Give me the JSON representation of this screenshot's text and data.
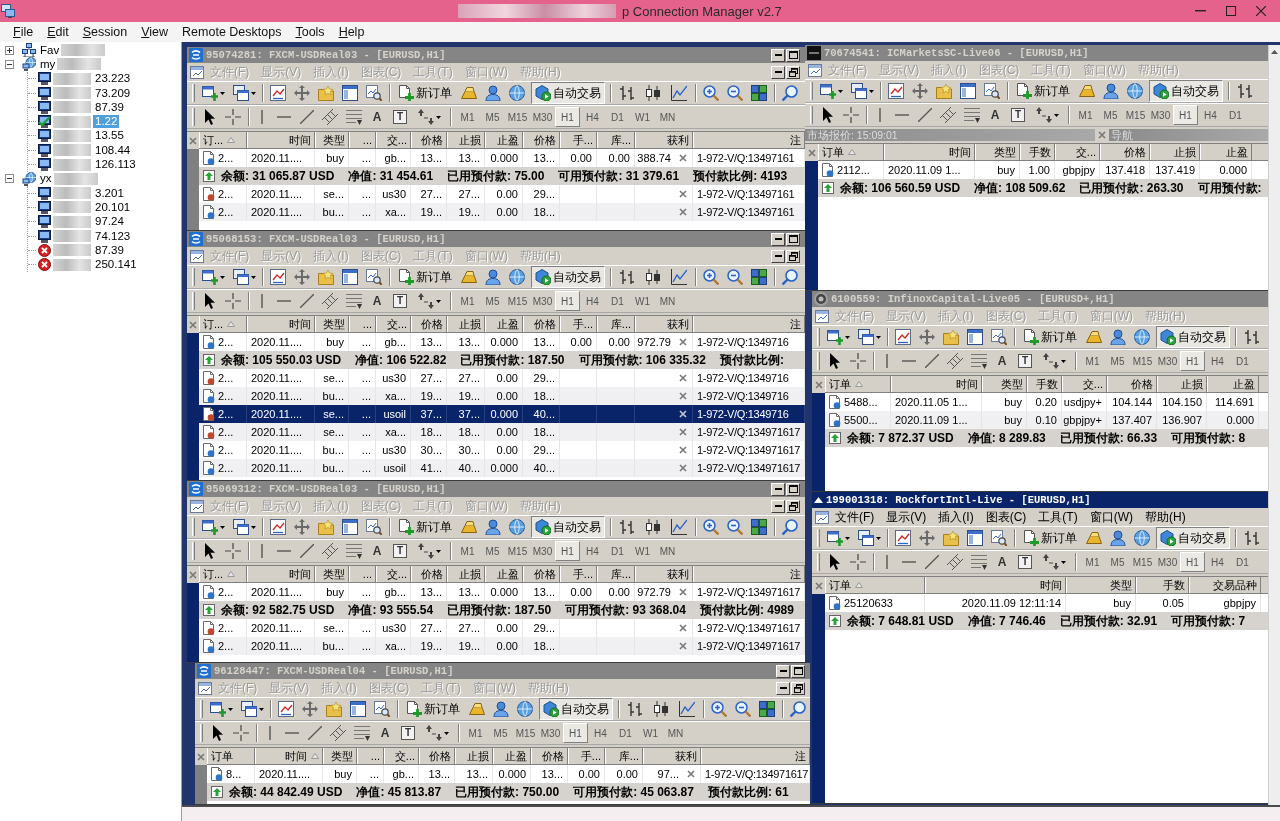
{
  "title_bar": {
    "title": "p Connection Manager v2.7"
  },
  "menu_bar": [
    {
      "label": "File",
      "underlined": true
    },
    {
      "label": "Edit",
      "underlined": true
    },
    {
      "label": "Session",
      "underlined": true
    },
    {
      "label": "View",
      "underlined": true
    },
    {
      "label": "Remote Desktops",
      "underlined": false
    },
    {
      "label": "Tools",
      "underlined": true
    },
    {
      "label": "Help",
      "underlined": true
    }
  ],
  "tree": [
    {
      "label": "Fav",
      "kind": "favorites",
      "expanded": false
    },
    {
      "label": "my",
      "kind": "group",
      "expanded": true,
      "children": [
        {
          "label": "23.223",
          "kind": "idle",
          "selected": false
        },
        {
          "label": "73.209",
          "kind": "idle",
          "selected": false
        },
        {
          "label": "87.39",
          "kind": "idle",
          "selected": false
        },
        {
          "label": "1.22",
          "kind": "connected",
          "selected": true
        },
        {
          "label": "13.55",
          "kind": "idle",
          "selected": false
        },
        {
          "label": "108.44",
          "kind": "idle",
          "selected": false
        },
        {
          "label": "126.113",
          "kind": "idle",
          "selected": false
        }
      ]
    },
    {
      "label": "yx",
      "kind": "group",
      "expanded": true,
      "children": [
        {
          "label": "3.201",
          "kind": "idle",
          "selected": false
        },
        {
          "label": "20.101",
          "kind": "idle",
          "selected": false
        },
        {
          "label": "97.24",
          "kind": "idle",
          "selected": false
        },
        {
          "label": "74.123",
          "kind": "idle",
          "selected": false
        },
        {
          "label": "87.39",
          "kind": "failed",
          "selected": false
        },
        {
          "label": "250.141",
          "kind": "failed",
          "selected": false
        }
      ]
    }
  ],
  "left_column": [
    {
      "kind": "swoosh",
      "title": "95074281: FXCM-USDReal03 - [EURUSD,H1]",
      "focused": false,
      "menu": [
        "文件(F)",
        "显示(V)",
        "插入(I)",
        "图表(C)",
        "工具(T)",
        "窗口(W)",
        "帮助(H)"
      ],
      "new_order": "新订单",
      "auto_trading": {
        "label": "自动交易",
        "on": true
      },
      "text_tool": "A",
      "label_tool": "T",
      "timeframes": [
        {
          "label": "M1",
          "selected": false
        },
        {
          "label": "M5",
          "selected": false
        },
        {
          "label": "M15",
          "selected": false
        },
        {
          "label": "M30",
          "selected": false
        },
        {
          "label": "H1",
          "selected": true
        },
        {
          "label": "H4",
          "selected": false
        },
        {
          "label": "D1",
          "selected": false
        },
        {
          "label": "W1",
          "selected": false
        },
        {
          "label": "MN",
          "selected": false
        }
      ],
      "terminal_focused": false,
      "columns": [
        {
          "label": "订...",
          "sorted": true
        },
        {
          "label": "时间",
          "sorted": false
        },
        {
          "label": "类型",
          "sorted": false
        },
        {
          "label": "...",
          "sorted": false
        },
        {
          "label": "交...",
          "sorted": false
        },
        {
          "label": "价格",
          "sorted": false
        },
        {
          "label": "止损",
          "sorted": false
        },
        {
          "label": "止盈",
          "sorted": false
        },
        {
          "label": "价格",
          "sorted": false
        },
        {
          "label": "手...",
          "sorted": false
        },
        {
          "label": "库...",
          "sorted": false
        },
        {
          "label": "获利",
          "sorted": false
        },
        {
          "label": "注",
          "sorted": false
        }
      ],
      "rows": [
        {
          "kind": "order",
          "selected": false,
          "color": "#2d74c6",
          "cells": [
            "2...",
            "2020.11....",
            "buy",
            "...",
            "gb...",
            "13...",
            "13...",
            "0.000",
            "13...",
            "0.00",
            "0.00",
            "388.74",
            "1-972-V/Q:13497161"
          ]
        },
        {
          "kind": "summary",
          "items": [
            "余额: 31 065.87 USD",
            "净值: 31 454.61",
            "已用预付款: 75.00",
            "可用预付款: 31 379.61",
            "预付款比例: 4193"
          ]
        },
        {
          "kind": "order",
          "selected": false,
          "color": "#c0462e",
          "cells": [
            "2...",
            "2020.11....",
            "se...",
            "...",
            "us30",
            "27...",
            "27...",
            "0.00",
            "29...",
            null,
            null,
            null,
            "1-972-V/Q:13497161"
          ]
        },
        {
          "kind": "order",
          "selected": false,
          "color": "#2d74c6",
          "cells": [
            "2...",
            "2020.11....",
            "bu...",
            "...",
            "xa...",
            "19...",
            "19...",
            "0.00",
            "18...",
            null,
            null,
            null,
            "1-972-V/Q:13497161"
          ]
        }
      ]
    },
    {
      "kind": "swoosh",
      "title": "95068153: FXCM-USDReal03 - [EURUSD,H1]",
      "focused": false,
      "menu": [
        "文件(F)",
        "显示(V)",
        "插入(I)",
        "图表(C)",
        "工具(T)",
        "窗口(W)",
        "帮助(H)"
      ],
      "new_order": "新订单",
      "auto_trading": {
        "label": "自动交易",
        "on": true
      },
      "text_tool": "A",
      "label_tool": "T",
      "timeframes": [
        {
          "label": "M1",
          "selected": false
        },
        {
          "label": "M5",
          "selected": false
        },
        {
          "label": "M15",
          "selected": false
        },
        {
          "label": "M30",
          "selected": false
        },
        {
          "label": "H1",
          "selected": true
        },
        {
          "label": "H4",
          "selected": false
        },
        {
          "label": "D1",
          "selected": false
        },
        {
          "label": "W1",
          "selected": false
        },
        {
          "label": "MN",
          "selected": false
        }
      ],
      "terminal_focused": true,
      "columns": [
        {
          "label": "订...",
          "sorted": true
        },
        {
          "label": "时间",
          "sorted": false
        },
        {
          "label": "类型",
          "sorted": false
        },
        {
          "label": "...",
          "sorted": false
        },
        {
          "label": "交...",
          "sorted": false
        },
        {
          "label": "价格",
          "sorted": false
        },
        {
          "label": "止损",
          "sorted": false
        },
        {
          "label": "止盈",
          "sorted": false
        },
        {
          "label": "价格",
          "sorted": false
        },
        {
          "label": "手...",
          "sorted": false
        },
        {
          "label": "库...",
          "sorted": false
        },
        {
          "label": "获利",
          "sorted": false
        },
        {
          "label": "注",
          "sorted": false
        }
      ],
      "rows": [
        {
          "kind": "order",
          "selected": false,
          "color": "#2d74c6",
          "cells": [
            "2...",
            "2020.11....",
            "buy",
            "...",
            "gb...",
            "13...",
            "13...",
            "0.000",
            "13...",
            "0.00",
            "0.00",
            "972.79",
            "1-972-V/Q:1349716"
          ]
        },
        {
          "kind": "summary",
          "items": [
            "余额: 105 550.03 USD",
            "净值: 106 522.82",
            "已用预付款: 187.50",
            "可用预付款: 106 335.32",
            "预付款比例:"
          ]
        },
        {
          "kind": "order",
          "selected": false,
          "color": "#c0462e",
          "cells": [
            "2...",
            "2020.11....",
            "se...",
            "...",
            "us30",
            "27...",
            "27...",
            "0.00",
            "29...",
            null,
            null,
            null,
            "1-972-V/Q:1349716"
          ]
        },
        {
          "kind": "order",
          "selected": false,
          "color": "#2d74c6",
          "cells": [
            "2...",
            "2020.11....",
            "bu...",
            "...",
            "xa...",
            "19...",
            "19...",
            "0.00",
            "18...",
            null,
            null,
            null,
            "1-972-V/Q:1349716"
          ]
        },
        {
          "kind": "order",
          "selected": true,
          "color": "#c0462e",
          "cells": [
            "2...",
            "2020.11....",
            "se...",
            "...",
            "usoil",
            "37...",
            "37...",
            "0.000",
            "40...",
            null,
            null,
            null,
            "1-972-V/Q:1349716"
          ]
        },
        {
          "kind": "order",
          "selected": false,
          "color": "#c0462e",
          "cells": [
            "2...",
            "2020.11....",
            "se...",
            "...",
            "xa...",
            "18...",
            "18...",
            "0.00",
            "18...",
            null,
            null,
            null,
            "1-972-V/Q:134971617"
          ]
        },
        {
          "kind": "order",
          "selected": false,
          "color": "#2d74c6",
          "cells": [
            "2...",
            "2020.11....",
            "bu...",
            "...",
            "us30",
            "30...",
            "30...",
            "0.00",
            "29...",
            null,
            null,
            null,
            "1-972-V/Q:134971617"
          ]
        },
        {
          "kind": "order",
          "selected": false,
          "color": "#2d74c6",
          "cells": [
            "2...",
            "2020.11....",
            "bu...",
            "...",
            "usoil",
            "41...",
            "40...",
            "0.000",
            "40...",
            null,
            null,
            null,
            "1-972-V/Q:134971617"
          ]
        }
      ]
    },
    {
      "kind": "swoosh",
      "title": "95069312: FXCM-USDReal03 - [EURUSD,H1]",
      "focused": false,
      "menu": [
        "文件(F)",
        "显示(V)",
        "插入(I)",
        "图表(C)",
        "工具(T)",
        "窗口(W)",
        "帮助(H)"
      ],
      "new_order": "新订单",
      "auto_trading": {
        "label": "自动交易",
        "on": true
      },
      "text_tool": "A",
      "label_tool": "T",
      "timeframes": [
        {
          "label": "M1",
          "selected": false
        },
        {
          "label": "M5",
          "selected": false
        },
        {
          "label": "M15",
          "selected": false
        },
        {
          "label": "M30",
          "selected": false
        },
        {
          "label": "H1",
          "selected": true
        },
        {
          "label": "H4",
          "selected": false
        },
        {
          "label": "D1",
          "selected": false
        },
        {
          "label": "W1",
          "selected": false
        },
        {
          "label": "MN",
          "selected": false
        }
      ],
      "terminal_focused": true,
      "columns": [
        {
          "label": "订...",
          "sorted": true
        },
        {
          "label": "时间",
          "sorted": false
        },
        {
          "label": "类型",
          "sorted": false
        },
        {
          "label": "...",
          "sorted": false
        },
        {
          "label": "交...",
          "sorted": false
        },
        {
          "label": "价格",
          "sorted": false
        },
        {
          "label": "止损",
          "sorted": false
        },
        {
          "label": "止盈",
          "sorted": false
        },
        {
          "label": "价格",
          "sorted": false
        },
        {
          "label": "手...",
          "sorted": false
        },
        {
          "label": "库...",
          "sorted": false
        },
        {
          "label": "获利",
          "sorted": false
        },
        {
          "label": "注",
          "sorted": false
        }
      ],
      "rows": [
        {
          "kind": "order",
          "selected": false,
          "color": "#2d74c6",
          "cells": [
            "2...",
            "2020.11....",
            "buy",
            "...",
            "gb...",
            "13...",
            "13...",
            "0.000",
            "13...",
            "0.00",
            "0.00",
            "972.79",
            "1-972-V/Q:134971617"
          ]
        },
        {
          "kind": "summary",
          "items": [
            "余额: 92 582.75 USD",
            "净值: 93 555.54",
            "已用预付款: 187.50",
            "可用预付款: 93 368.04",
            "预付款比例: 4989"
          ]
        },
        {
          "kind": "order",
          "selected": false,
          "color": "#c0462e",
          "cells": [
            "2...",
            "2020.11....",
            "se...",
            "...",
            "us30",
            "27...",
            "27...",
            "0.00",
            "29...",
            null,
            null,
            null,
            "1-972-V/Q:134971617"
          ]
        },
        {
          "kind": "order",
          "selected": false,
          "color": "#2d74c6",
          "cells": [
            "2...",
            "2020.11....",
            "bu...",
            "...",
            "xa...",
            "19...",
            "19...",
            "0.00",
            "18...",
            null,
            null,
            null,
            "1-972-V/Q:134971617"
          ]
        }
      ]
    },
    {
      "kind": "swoosh",
      "title": "96128447: FXCM-USDReal04 - [EURUSD,H1]",
      "focused": false,
      "menu": [
        "文件(F)",
        "显示(V)",
        "插入(I)",
        "图表(C)",
        "工具(T)",
        "窗口(W)",
        "帮助(H)"
      ],
      "new_order": "新订单",
      "auto_trading": {
        "label": "自动交易",
        "on": true
      },
      "text_tool": "A",
      "label_tool": "T",
      "timeframes": [
        {
          "label": "M1",
          "selected": false
        },
        {
          "label": "M5",
          "selected": false
        },
        {
          "label": "M15",
          "selected": false
        },
        {
          "label": "M30",
          "selected": false
        },
        {
          "label": "H1",
          "selected": true
        },
        {
          "label": "H4",
          "selected": false
        },
        {
          "label": "D1",
          "selected": false
        },
        {
          "label": "W1",
          "selected": false
        },
        {
          "label": "MN",
          "selected": false
        }
      ],
      "terminal_focused": false,
      "columns": [
        {
          "label": "订单",
          "sorted": false
        },
        {
          "label": "时间",
          "sorted": true
        },
        {
          "label": "类型",
          "sorted": false
        },
        {
          "label": "...",
          "sorted": false
        },
        {
          "label": "交...",
          "sorted": false
        },
        {
          "label": "价格",
          "sorted": false
        },
        {
          "label": "止损",
          "sorted": false
        },
        {
          "label": "止盈",
          "sorted": false
        },
        {
          "label": "价格",
          "sorted": false
        },
        {
          "label": "手...",
          "sorted": false
        },
        {
          "label": "库...",
          "sorted": false
        },
        {
          "label": "获利",
          "sorted": false
        },
        {
          "label": "注",
          "sorted": false
        }
      ],
      "rows": [
        {
          "kind": "order",
          "selected": false,
          "color": "#2d74c6",
          "cells": [
            "8...",
            "2020.11....",
            "buy",
            "...",
            "gb...",
            "13...",
            "13...",
            "0.000",
            "13...",
            "0.00",
            "0.00",
            "97...",
            "1-972-V/Q:134971617"
          ]
        },
        {
          "kind": "summary",
          "items": [
            "余额: 44 842.49 USD",
            "净值: 45 813.87",
            "已用预付款: 750.00",
            "可用预付款: 45 063.87",
            "预付款比例: 61"
          ]
        }
      ]
    }
  ],
  "right_column": [
    {
      "kind": "dash",
      "title": "70674541: ICMarketsSC-Live06 - [EURUSD,H1]",
      "focused": false,
      "menu": [
        "文件(F)",
        "显示(V)",
        "插入(I)",
        "图表(C)",
        "工具(T)",
        "窗口(W)",
        "帮助(H)"
      ],
      "new_order": "新订单",
      "auto_trading": {
        "label": "自动交易",
        "on": true
      },
      "text_tool": "A",
      "label_tool": "T",
      "timeframes": [
        {
          "label": "M1",
          "selected": false
        },
        {
          "label": "M5",
          "selected": false
        },
        {
          "label": "M15",
          "selected": false
        },
        {
          "label": "M30",
          "selected": false
        },
        {
          "label": "H1",
          "selected": true
        },
        {
          "label": "H4",
          "selected": false
        },
        {
          "label": "D1",
          "selected": false
        }
      ],
      "docked_panels": [
        {
          "title": "市场报价: 15:09:01"
        },
        {
          "title": "导航"
        }
      ],
      "terminal_focused": true,
      "columns": [
        {
          "label": "订单",
          "sorted": true
        },
        {
          "label": "时间",
          "sorted": false
        },
        {
          "label": "类型",
          "sorted": false
        },
        {
          "label": "手数",
          "sorted": false
        },
        {
          "label": "交...",
          "sorted": false
        },
        {
          "label": "价格",
          "sorted": false
        },
        {
          "label": "止损",
          "sorted": false
        },
        {
          "label": "止盈",
          "sorted": false
        }
      ],
      "rows": [
        {
          "kind": "order",
          "selected": false,
          "color": "#2d74c6",
          "cells": [
            "2112...",
            "2020.11.09 1...",
            "buy",
            "1.00",
            "gbpjpy",
            "137.418",
            "137.419",
            "0.000"
          ]
        },
        {
          "kind": "summary",
          "items": [
            "余额: 106 560.59 USD",
            "净值: 108 509.62",
            "已用预付款: 263.30",
            "可用预付款:"
          ]
        }
      ]
    },
    {
      "kind": "ring",
      "title": "6100559: InfinoxCapital-Live05 - [EURUSD+,H1]",
      "focused": false,
      "menu": [
        "文件(F)",
        "显示(V)",
        "插入(I)",
        "图表(C)",
        "工具(T)",
        "窗口(W)",
        "帮助(H)"
      ],
      "new_order": "新订单",
      "auto_trading": {
        "label": "自动交易",
        "on": true
      },
      "text_tool": "A",
      "label_tool": "T",
      "timeframes": [
        {
          "label": "M1",
          "selected": false
        },
        {
          "label": "M5",
          "selected": false
        },
        {
          "label": "M15",
          "selected": false
        },
        {
          "label": "M30",
          "selected": false
        },
        {
          "label": "H1",
          "selected": true
        },
        {
          "label": "H4",
          "selected": false
        },
        {
          "label": "D1",
          "selected": false
        }
      ],
      "terminal_focused": true,
      "columns": [
        {
          "label": "订单",
          "sorted": true
        },
        {
          "label": "时间",
          "sorted": false
        },
        {
          "label": "类型",
          "sorted": false
        },
        {
          "label": "手数",
          "sorted": false
        },
        {
          "label": "交...",
          "sorted": false
        },
        {
          "label": "价格",
          "sorted": false
        },
        {
          "label": "止损",
          "sorted": false
        },
        {
          "label": "止盈",
          "sorted": false
        }
      ],
      "rows": [
        {
          "kind": "order",
          "selected": false,
          "color": "#2d74c6",
          "cells": [
            "5488...",
            "2020.11.05 1...",
            "buy",
            "0.20",
            "usdjpy+",
            "104.144",
            "104.150",
            "114.691"
          ]
        },
        {
          "kind": "order",
          "selected": false,
          "color": "#2d74c6",
          "cells": [
            "5500...",
            "2020.11.09 1...",
            "buy",
            "0.10",
            "gbpjpy+",
            "137.407",
            "136.907",
            "0.000"
          ]
        },
        {
          "kind": "summary",
          "items": [
            "余额: 7 872.37 USD",
            "净值: 8 289.83",
            "已用预付款: 66.33",
            "可用预付款: 8"
          ]
        }
      ]
    },
    {
      "kind": "caret",
      "title": "199001318: RockfortIntl-Live - [EURUSD,H1]",
      "focused": true,
      "menu": [
        "文件(F)",
        "显示(V)",
        "插入(I)",
        "图表(C)",
        "工具(T)",
        "窗口(W)",
        "帮助(H)"
      ],
      "new_order": "新订单",
      "auto_trading": {
        "label": "自动交易",
        "on": true
      },
      "text_tool": "A",
      "label_tool": "T",
      "timeframes": [
        {
          "label": "M1",
          "selected": false
        },
        {
          "label": "M5",
          "selected": false
        },
        {
          "label": "M15",
          "selected": false
        },
        {
          "label": "M30",
          "selected": false
        },
        {
          "label": "H1",
          "selected": true
        },
        {
          "label": "H4",
          "selected": false
        },
        {
          "label": "D1",
          "selected": false
        }
      ],
      "terminal_focused": true,
      "columns": [
        {
          "label": "订单",
          "sorted": true
        },
        {
          "label": "时间",
          "sorted": false
        },
        {
          "label": "类型",
          "sorted": false
        },
        {
          "label": "手数",
          "sorted": false
        },
        {
          "label": "交易品种",
          "sorted": false
        }
      ],
      "rows": [
        {
          "kind": "order",
          "selected": false,
          "color": "#2d74c6",
          "cells": [
            "25120633",
            "2020.11.09 12:11:14",
            "buy",
            "0.05",
            "gbpjpy"
          ]
        },
        {
          "kind": "summary",
          "items": [
            "余额: 7 648.81 USD",
            "净值: 7 746.46",
            "已用预付款: 32.91",
            "可用预付款: 7"
          ]
        }
      ]
    }
  ]
}
